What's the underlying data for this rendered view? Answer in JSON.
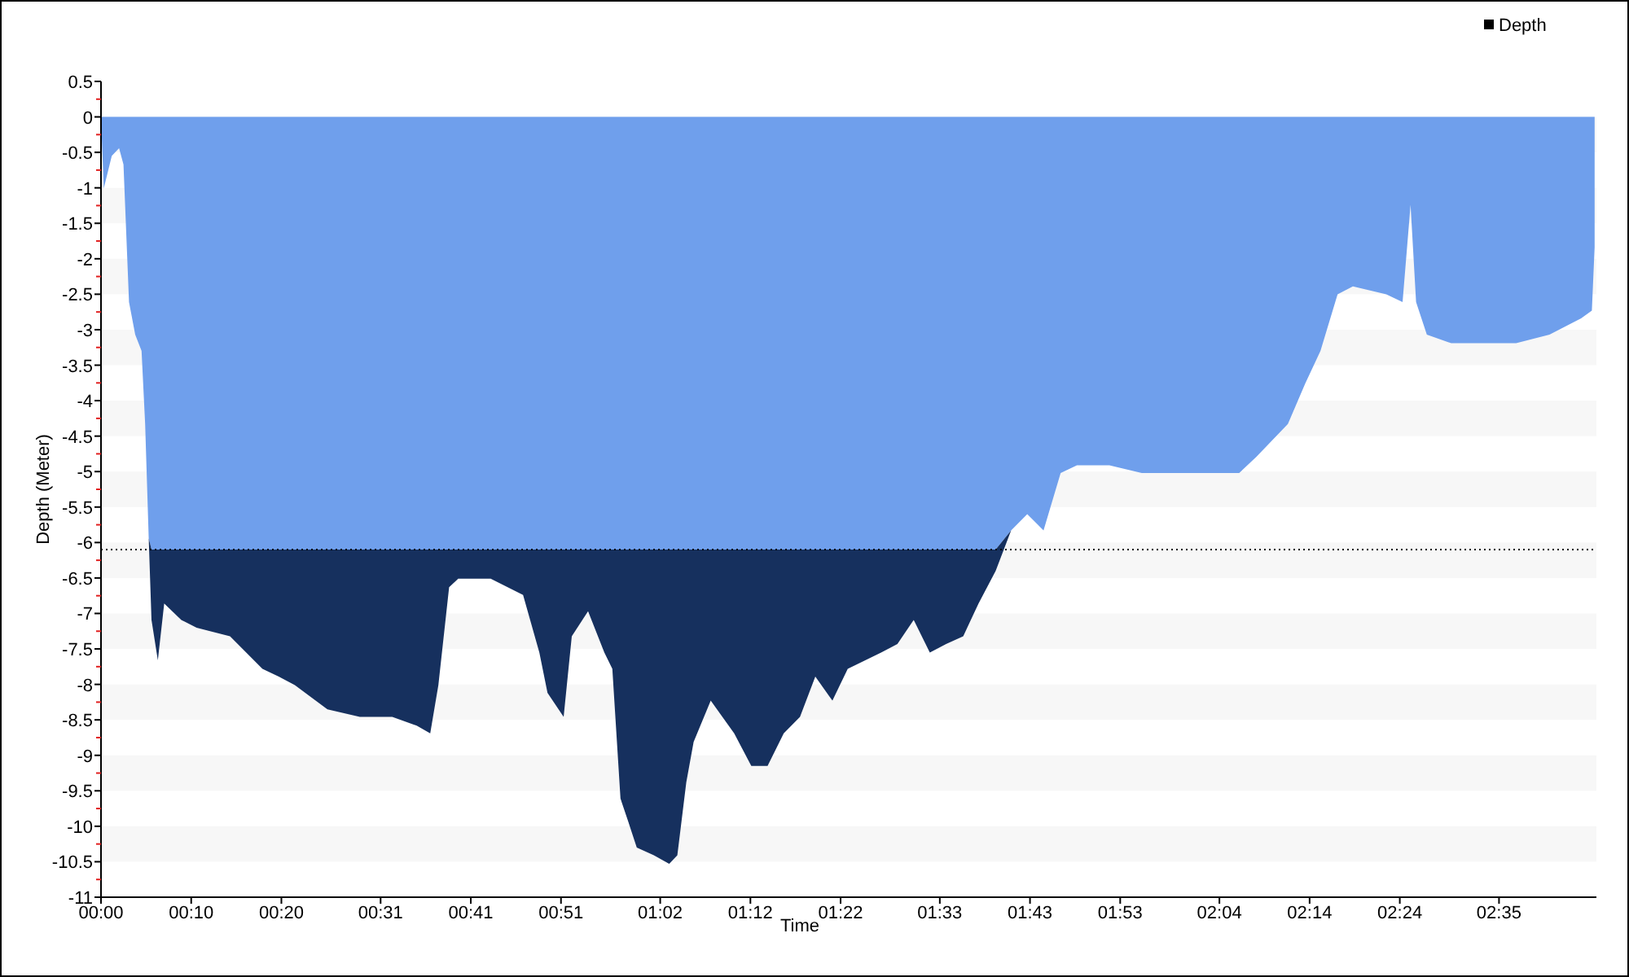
{
  "chart_data": {
    "type": "area",
    "xlabel": "Time",
    "ylabel": "Depth (Meter)",
    "stacked": true,
    "x": [
      0,
      0.3,
      1.2,
      2.0,
      2.5,
      3.1,
      3.8,
      4.5,
      4.9,
      5.3,
      5.6,
      6.3,
      7.0,
      8.9,
      10.6,
      14.3,
      17.9,
      19.7,
      21.5,
      25.1,
      28.7,
      32.3,
      35.0,
      36.5,
      37.4,
      38.6,
      39.6,
      43.2,
      46.8,
      48.6,
      49.5,
      51.3,
      52.2,
      54.0,
      55.8,
      56.7,
      57.6,
      58.5,
      59.4,
      61.3,
      63.0,
      63.9,
      64.9,
      65.7,
      67.6,
      70.2,
      72.1,
      73.9,
      75.7,
      77.5,
      79.2,
      81.1,
      82.8,
      86.5,
      88.3,
      90.1,
      91.9,
      93.7,
      95.6,
      97.3,
      99.2,
      100.9,
      102.7,
      104.5,
      106.4,
      108.2,
      111.8,
      115.4,
      119.0,
      122.6,
      126.2,
      128.1,
      131.6,
      133.5,
      135.2,
      137.1,
      138.8,
      142.5,
      144.3,
      145.2,
      145.8,
      147.0,
      149.7,
      153.3,
      156.9,
      160.6,
      164.1,
      165.3,
      165.6
    ],
    "series": [
      {
        "name": "Depth",
        "color": "#6f9fec",
        "values": [
          0,
          -1.01,
          -0.55,
          -0.44,
          -0.67,
          -2.61,
          -3.07,
          -3.3,
          -4.33,
          -5.94,
          -6.1,
          -6.1,
          -6.1,
          -6.1,
          -6.1,
          -6.1,
          -6.1,
          -6.1,
          -6.1,
          -6.1,
          -6.1,
          -6.1,
          -6.1,
          -6.1,
          -6.1,
          -6.1,
          -6.1,
          -6.1,
          -6.1,
          -6.1,
          -6.1,
          -6.1,
          -6.1,
          -6.1,
          -6.1,
          -6.1,
          -6.1,
          -6.1,
          -6.1,
          -6.1,
          -6.1,
          -6.1,
          -6.1,
          -6.1,
          -6.1,
          -6.1,
          -6.1,
          -6.1,
          -6.1,
          -6.1,
          -6.1,
          -6.1,
          -6.1,
          -6.1,
          -6.1,
          -6.1,
          -6.1,
          -6.1,
          -6.1,
          -6.1,
          -6.1,
          -5.83,
          -5.6,
          -5.83,
          -5.02,
          -4.91,
          -4.91,
          -5.02,
          -5.02,
          -5.02,
          -5.02,
          -4.79,
          -4.33,
          -3.76,
          -3.3,
          -2.5,
          -2.39,
          -2.5,
          -2.61,
          -1.24,
          -2.61,
          -3.07,
          -3.19,
          -3.19,
          -3.19,
          -3.07,
          -2.84,
          -2.73,
          -1.84
        ]
      },
      {
        "color": "#16305e",
        "values": [
          0,
          0,
          0,
          0,
          0,
          0,
          0,
          0,
          0,
          0,
          -0.99,
          -1.56,
          -0.76,
          -0.99,
          -1.1,
          -1.22,
          -1.68,
          -1.79,
          -1.91,
          -2.25,
          -2.36,
          -2.36,
          -2.48,
          -2.59,
          -1.91,
          -0.53,
          -0.41,
          -0.41,
          -0.64,
          -1.45,
          -2.02,
          -2.36,
          -1.22,
          -0.87,
          -1.45,
          -1.68,
          -3.51,
          -3.85,
          -4.2,
          -4.31,
          -4.43,
          -4.31,
          -3.28,
          -2.71,
          -2.13,
          -2.59,
          -3.05,
          -3.05,
          -2.59,
          -2.36,
          -1.79,
          -2.13,
          -1.68,
          -1.45,
          -1.33,
          -0.99,
          -1.45,
          -1.33,
          -1.22,
          -0.76,
          -0.3,
          0,
          0,
          0,
          0,
          0,
          0,
          0,
          0,
          0,
          0,
          0,
          0,
          0,
          0,
          0,
          0,
          0,
          0,
          0,
          0,
          0,
          0,
          0,
          0,
          0,
          0,
          0,
          0
        ]
      }
    ],
    "xlim": [
      0,
      165.8
    ],
    "ylim": [
      -11,
      0.5
    ],
    "xticks": [
      {
        "value": 0,
        "label": "00:00"
      },
      {
        "value": 10,
        "label": "00:10"
      },
      {
        "value": 20,
        "label": "00:20"
      },
      {
        "value": 31,
        "label": "00:31"
      },
      {
        "value": 41,
        "label": "00:41"
      },
      {
        "value": 51,
        "label": "00:51"
      },
      {
        "value": 62,
        "label": "01:02"
      },
      {
        "value": 72,
        "label": "01:12"
      },
      {
        "value": 82,
        "label": "01:22"
      },
      {
        "value": 93,
        "label": "01:33"
      },
      {
        "value": 103,
        "label": "01:43"
      },
      {
        "value": 113,
        "label": "01:53"
      },
      {
        "value": 124,
        "label": "02:04"
      },
      {
        "value": 134,
        "label": "02:14"
      },
      {
        "value": 144,
        "label": "02:24"
      },
      {
        "value": 155,
        "label": "02:35"
      }
    ],
    "yticks": [
      0.5,
      0,
      -0.5,
      -1,
      -1.5,
      -2,
      -2.5,
      -3,
      -3.5,
      -4,
      -4.5,
      -5,
      -5.5,
      -6,
      -6.5,
      -7,
      -7.5,
      -8,
      -8.5,
      -9,
      -9.5,
      -10,
      -10.5,
      -11
    ],
    "ref_lines": [
      {
        "axis": "y",
        "value": -6.1,
        "color": "#000000"
      }
    ]
  }
}
